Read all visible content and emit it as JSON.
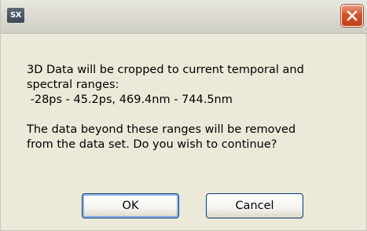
{
  "window": {
    "title": "",
    "icon_text": "SX",
    "icon": "app-logo-icon",
    "close_icon": "close-icon"
  },
  "message": {
    "lines": [
      "3D Data will be cropped to current temporal and",
      "spectral ranges:",
      " -28ps - 45.2ps, 469.4nm - 744.5nm",
      "",
      "The data beyond these ranges will be removed",
      "from the data set. Do you wish to continue?"
    ]
  },
  "buttons": {
    "ok_label": "OK",
    "cancel_label": "Cancel"
  },
  "colors": {
    "dialog_background": "#ece9d8",
    "close_button": "#d2542c",
    "button_border": "#003c74"
  }
}
